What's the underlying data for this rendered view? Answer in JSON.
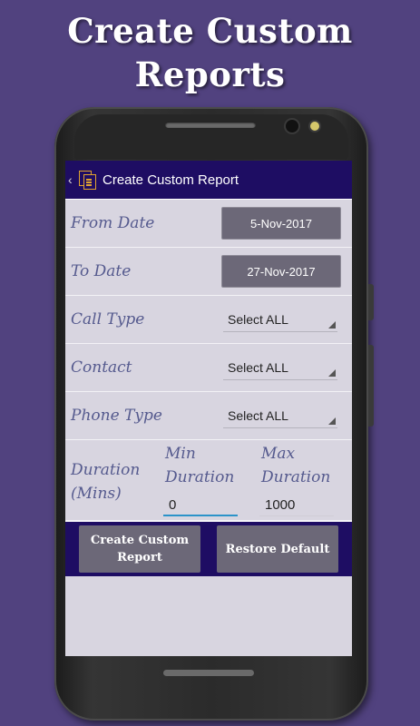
{
  "banner": {
    "line1": "Create Custom",
    "line2": "Reports"
  },
  "appbar": {
    "back_glyph": "‹",
    "title": "Create Custom Report"
  },
  "form": {
    "from_date": {
      "label": "From Date",
      "value": "5-Nov-2017"
    },
    "to_date": {
      "label": "To Date",
      "value": "27-Nov-2017"
    },
    "call_type": {
      "label": "Call Type",
      "value": "Select ALL"
    },
    "contact": {
      "label": "Contact",
      "value": "Select ALL"
    },
    "phone_type": {
      "label": "Phone Type",
      "value": "Select ALL"
    },
    "duration": {
      "label_line1": "Duration",
      "label_line2": "(Mins)",
      "min_label_line1": "Min",
      "min_label_line2": "Duration",
      "min_value": "0",
      "max_label_line1": "Max",
      "max_label_line2": "Duration",
      "max_value": "1000"
    }
  },
  "actions": {
    "create_label": "Create Custom Report",
    "restore_label": "Restore Default"
  },
  "colors": {
    "background": "#51427f",
    "appbar": "#1e0d63",
    "button": "#6c6878",
    "label": "#555a8e",
    "accent": "#2b93c9"
  }
}
